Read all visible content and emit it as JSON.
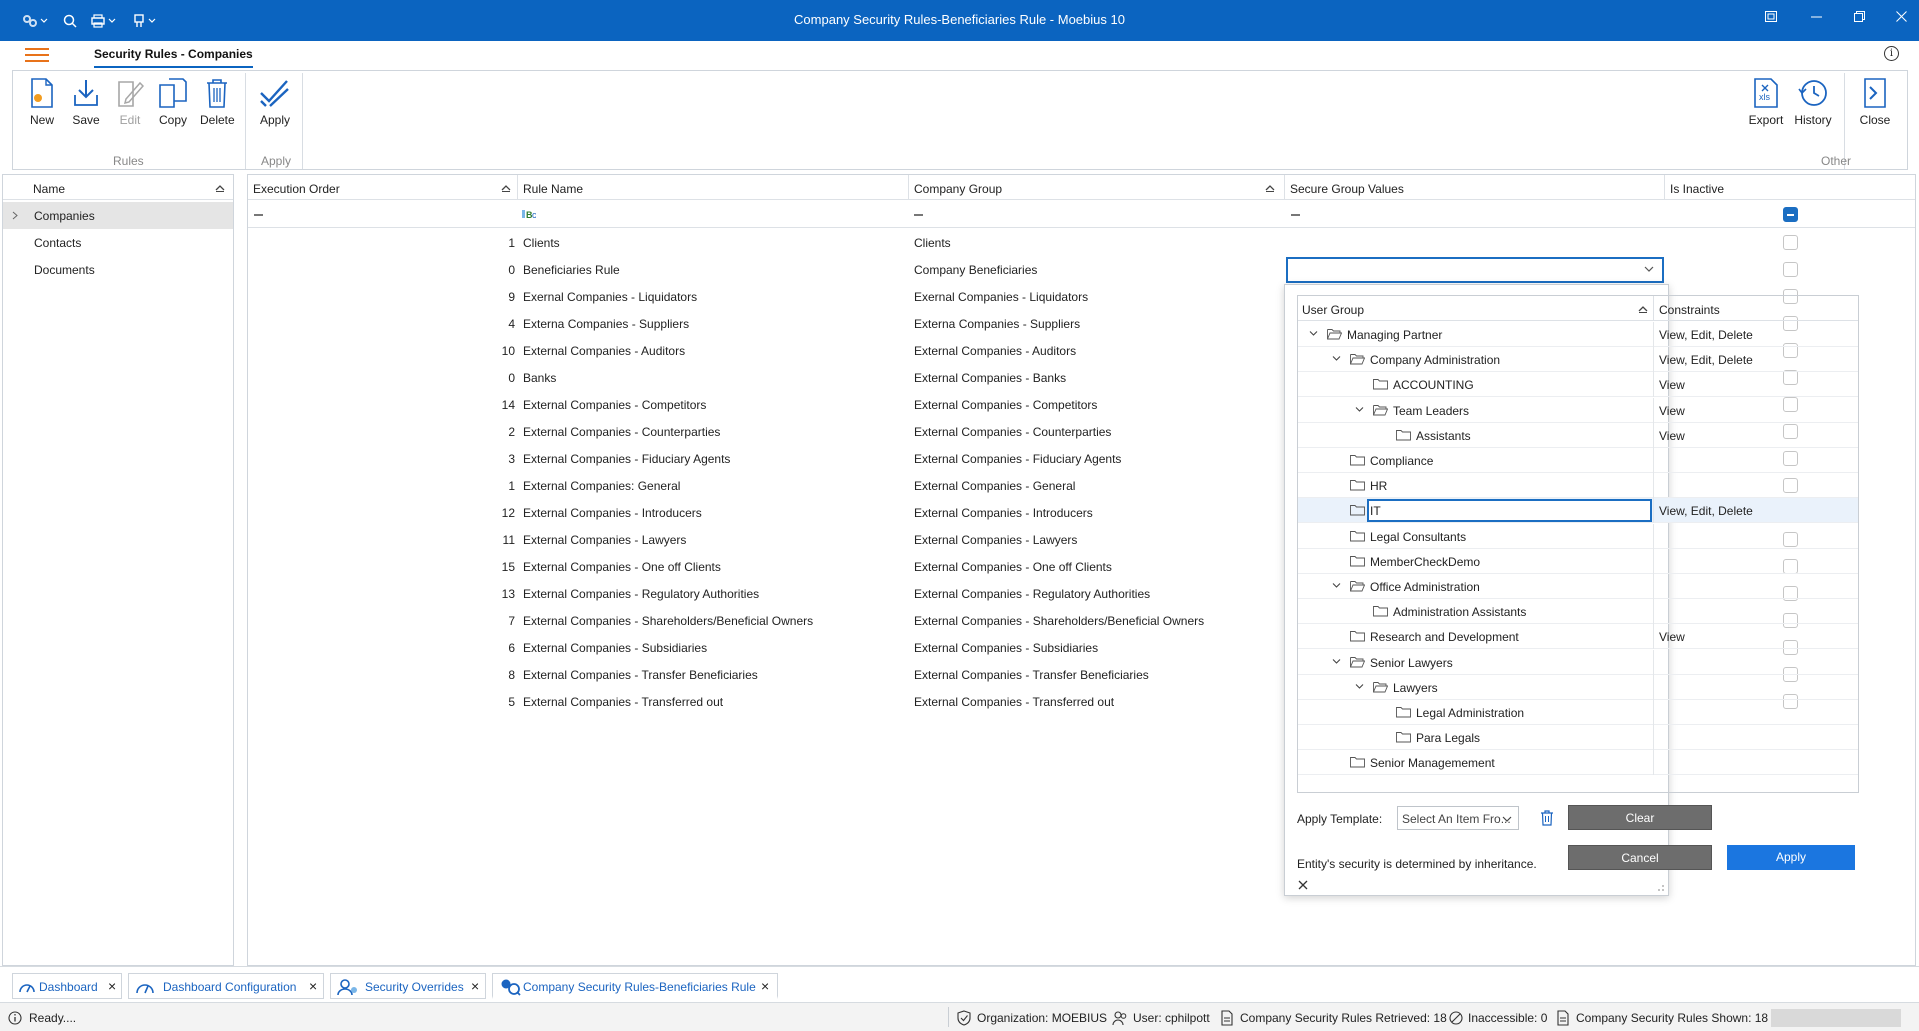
{
  "window": {
    "title": "Company Security Rules-Beneficiaries Rule - Moebius 10"
  },
  "ribbon": {
    "tab": "Security Rules - Companies",
    "buttons": {
      "new": "New",
      "save": "Save",
      "edit": "Edit",
      "copy": "Copy",
      "delete": "Delete",
      "apply": "Apply",
      "export": "Export",
      "history": "History",
      "close": "Close"
    },
    "groups": {
      "rules": "Rules",
      "apply": "Apply",
      "other": "Other"
    }
  },
  "left_panel": {
    "header": "Name",
    "items": [
      "Companies",
      "Contacts",
      "Documents"
    ]
  },
  "grid": {
    "headers": {
      "execution_order": "Execution Order",
      "rule_name": "Rule Name",
      "company_group": "Company Group",
      "secure_group_values": "Secure Group Values",
      "is_inactive": "Is Inactive"
    },
    "rows": [
      {
        "order": "1",
        "name": "Clients",
        "group": "Clients"
      },
      {
        "order": "0",
        "name": "Beneficiaries Rule",
        "group": "Company Beneficiaries"
      },
      {
        "order": "9",
        "name": "Exernal Companies - Liquidators",
        "group": "Exernal Companies - Liquidators"
      },
      {
        "order": "4",
        "name": "Externa Companies - Suppliers",
        "group": "Externa Companies - Suppliers"
      },
      {
        "order": "10",
        "name": "External Companies - Auditors",
        "group": "External Companies - Auditors"
      },
      {
        "order": "0",
        "name": "Banks",
        "group": "External Companies - Banks"
      },
      {
        "order": "14",
        "name": "External Companies - Competitors",
        "group": "External Companies - Competitors"
      },
      {
        "order": "2",
        "name": "External Companies - Counterparties",
        "group": "External Companies - Counterparties"
      },
      {
        "order": "3",
        "name": "External Companies - Fiduciary Agents",
        "group": "External Companies - Fiduciary Agents"
      },
      {
        "order": "1",
        "name": "External Companies: General",
        "group": "External Companies - General"
      },
      {
        "order": "12",
        "name": "External Companies - Introducers",
        "group": "External Companies - Introducers"
      },
      {
        "order": "11",
        "name": "External Companies - Lawyers",
        "group": "External Companies - Lawyers"
      },
      {
        "order": "15",
        "name": "External Companies - One off Clients",
        "group": "External Companies - One off Clients"
      },
      {
        "order": "13",
        "name": "External Companies - Regulatory Authorities",
        "group": "External Companies - Regulatory Authorities"
      },
      {
        "order": "7",
        "name": "External Companies - Shareholders/Beneficial Owners",
        "group": "External Companies - Shareholders/Beneficial Owners"
      },
      {
        "order": "6",
        "name": "External Companies - Subsidiaries",
        "group": "External Companies - Subsidiaries"
      },
      {
        "order": "8",
        "name": "External Companies - Transfer Beneficiaries",
        "group": "External Companies - Transfer Beneficiaries"
      },
      {
        "order": "5",
        "name": "External Companies - Transferred out",
        "group": "External Companies - Transferred out"
      }
    ]
  },
  "popup": {
    "headers": {
      "user_group": "User Group",
      "constraints": "Constraints"
    },
    "tree": [
      {
        "label": "Managing Partner",
        "constraints": "View, Edit, Delete",
        "level": 0,
        "expanded": true
      },
      {
        "label": "Company Administration",
        "constraints": "View, Edit, Delete",
        "level": 1,
        "expanded": true
      },
      {
        "label": "ACCOUNTING",
        "constraints": "View",
        "level": 2,
        "expanded": false
      },
      {
        "label": "Team Leaders",
        "constraints": "View",
        "level": 2,
        "expanded": true
      },
      {
        "label": "Assistants",
        "constraints": "View",
        "level": 3,
        "expanded": false
      },
      {
        "label": "Compliance",
        "constraints": "",
        "level": 1,
        "expanded": false
      },
      {
        "label": "HR",
        "constraints": "",
        "level": 1,
        "expanded": false
      },
      {
        "label": "IT",
        "constraints": "View, Edit, Delete",
        "level": 1,
        "expanded": false,
        "selected": true
      },
      {
        "label": "Legal Consultants",
        "constraints": "",
        "level": 1,
        "expanded": false
      },
      {
        "label": "MemberCheckDemo",
        "constraints": "",
        "level": 1,
        "expanded": false
      },
      {
        "label": "Office Administration",
        "constraints": "",
        "level": 1,
        "expanded": true
      },
      {
        "label": "Administration Assistants",
        "constraints": "",
        "level": 2,
        "expanded": false
      },
      {
        "label": "Research and Development",
        "constraints": "View",
        "level": 1,
        "expanded": false
      },
      {
        "label": "Senior Lawyers",
        "constraints": "",
        "level": 1,
        "expanded": true
      },
      {
        "label": "Lawyers",
        "constraints": "",
        "level": 2,
        "expanded": true
      },
      {
        "label": "Legal Administration",
        "constraints": "",
        "level": 3,
        "expanded": false
      },
      {
        "label": "Para Legals",
        "constraints": "",
        "level": 3,
        "expanded": false
      },
      {
        "label": "Senior Managemement",
        "constraints": "",
        "level": 1,
        "expanded": false
      }
    ],
    "apply_template_label": "Apply Template:",
    "template_placeholder": "Select An Item Fro...",
    "clear": "Clear",
    "cancel": "Cancel",
    "apply": "Apply",
    "inheritance_note": "Entity's security is determined by inheritance."
  },
  "doc_tabs": [
    "Dashboard",
    "Dashboard Configuration",
    "Security Overrides",
    "Company Security Rules-Beneficiaries Rule"
  ],
  "status": {
    "ready": "Ready....",
    "organization": "Organization: MOEBIUS",
    "user": "User: cphilpott",
    "retrieved": "Company Security Rules Retrieved: 18",
    "inaccessible": "Inaccessible: 0",
    "shown": "Company Security Rules Shown: 18"
  },
  "colors": {
    "titlebar": "#0b64c0",
    "accent": "#1b6ec2",
    "hamburger": "#e8731a",
    "apply_button": "#1b76e0"
  }
}
